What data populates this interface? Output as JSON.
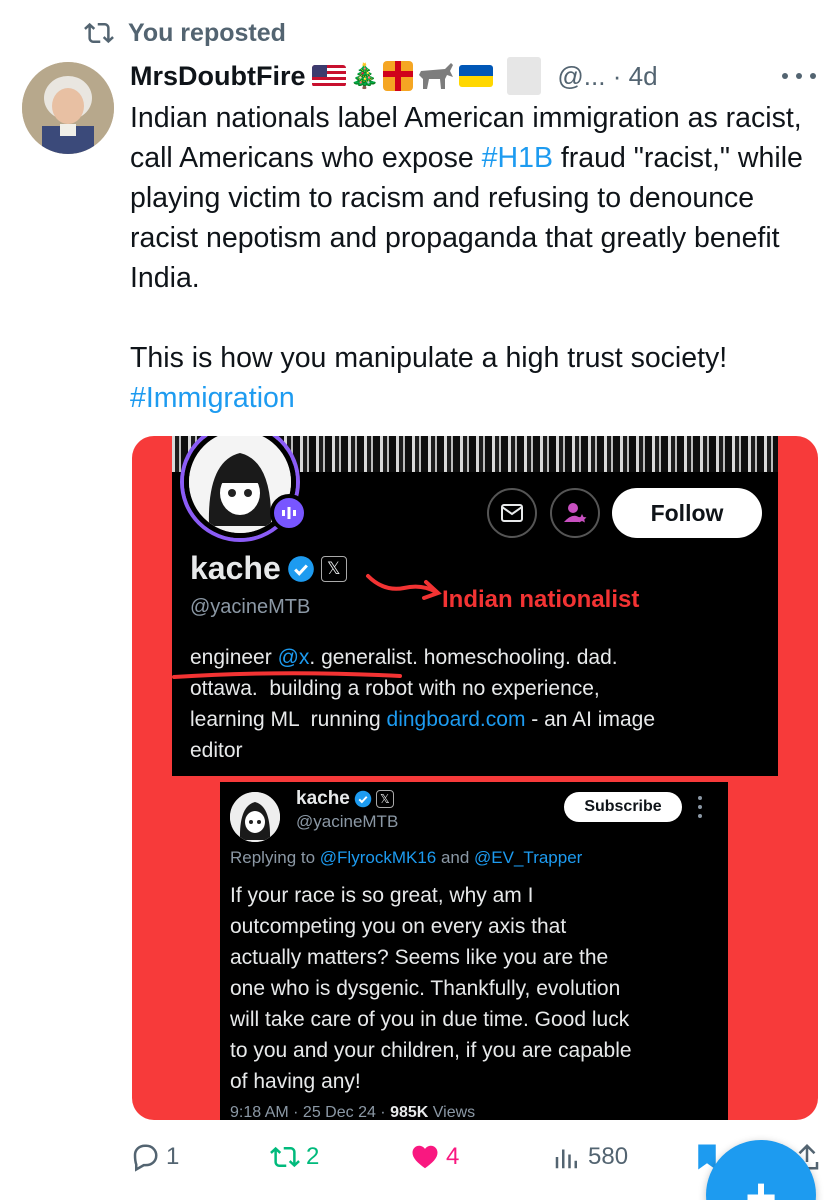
{
  "repost": {
    "label": "You reposted",
    "icon": "repost-icon"
  },
  "tweet": {
    "author_name": "MrsDoubtFire",
    "emoji_names": [
      "us-flag",
      "christmas-tree",
      "gift",
      "donkey",
      "ukraine-flag"
    ],
    "handle": "@...",
    "time": "4d",
    "handle_time_sep": "·",
    "text_part1": "Indian nationals label American immigration as racist, call Americans who expose ",
    "hashtag1": "#H1B",
    "text_part2": " fraud \"racist,\" while playing victim to racism and refusing to denounce racist nepotism and propaganda that greatly benefit India.\n\nThis is how you manipulate a high trust society!\n",
    "hashtag2": "#Immigration"
  },
  "media": {
    "background_color": "#f73a3a",
    "profile": {
      "follow_label": "Follow",
      "name": "kache",
      "handle": "@yacineMTB",
      "annotation": "Indian nationalist",
      "bio_part1": "engineer ",
      "bio_mention": "@x",
      "bio_part2": ". generalist. homeschooling. dad.\nottawa.  building a robot with no experience,\nlearning ML  running ",
      "bio_link": "dingboard.com",
      "bio_part3": " - an AI image\neditor"
    },
    "reply": {
      "name": "kache",
      "handle": "@yacineMTB",
      "subscribe_label": "Subscribe",
      "replying_prefix": "Replying to ",
      "replying_user1": "@FlyrockMK16",
      "replying_and": " and ",
      "replying_user2": "@EV_Trapper",
      "text": "If your race is so great, why am I\noutcompeting you on every axis that\nactually matters? Seems like you are the\none who is dysgenic. Thankfully, evolution\nwill take care of you in due time. Good luck\nto you and your children, if you are capable\nof having any!",
      "meta_time": "9:18 AM · 25 Dec 24 · ",
      "meta_views": "985K",
      "meta_views_label": " Views"
    }
  },
  "actions": {
    "replies": "1",
    "reposts": "2",
    "likes": "4",
    "views": "580"
  },
  "fab_label": "+",
  "colors": {
    "accent": "#1d9bf0",
    "repost": "#00ba7c",
    "like": "#f91880",
    "annotation": "#f33333"
  }
}
